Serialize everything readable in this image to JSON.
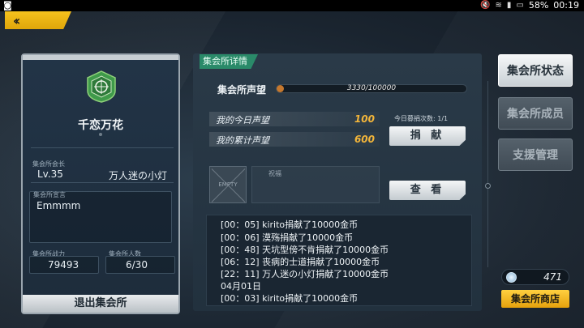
{
  "status_bar": {
    "left_icon": "notification-icon",
    "battery": "58%",
    "time": "00:19"
  },
  "guild": {
    "name": "千恋万花",
    "leader_label": "集会所会长",
    "level": "Lv.35",
    "leader_name": "万人迷の小灯",
    "motto_label": "集会所宣言",
    "motto": "Emmmm",
    "power_label": "集会所战力",
    "power": "79493",
    "members_label": "集会所人数",
    "members": "6/30",
    "exit_label": "退出集会所"
  },
  "details": {
    "tab_label": "集会所详情",
    "reputation_label": "集会所声望",
    "reputation_text": "3330/100000",
    "reputation_fraction": 0.0333,
    "today_label": "我的今日声望",
    "today_value": "100",
    "total_label": "我的累计声望",
    "total_value": "600",
    "donate_count": "今日募捐次数: 1/1",
    "donate_button": "捐 献",
    "empty_text": "EMPTY",
    "blessing_label": "祝福",
    "view_button": "查 看"
  },
  "log": [
    "[00：05] kirito捐献了10000金币",
    "[00：06] 漠殇捐献了10000金币",
    "[00：48] 天坑型傍不肯捐献了10000金币",
    "[06：12] 丧病的士道捐献了10000金币",
    "[22：11] 万人迷の小灯捐献了10000金币",
    "04月01日",
    "[00：03] kirito捐献了10000金币"
  ],
  "side_nav": [
    {
      "label": "集会所状态",
      "active": true
    },
    {
      "label": "集会所成员",
      "active": false
    },
    {
      "label": "支援管理",
      "active": false
    }
  ],
  "currency": {
    "icon": "crystal-icon",
    "value": "471"
  },
  "shop_button": "集会所商店",
  "colors": {
    "accent_gold": "#f2b53a",
    "tab_green": "#2a8a69",
    "reputation_fill": "#c5782e"
  }
}
